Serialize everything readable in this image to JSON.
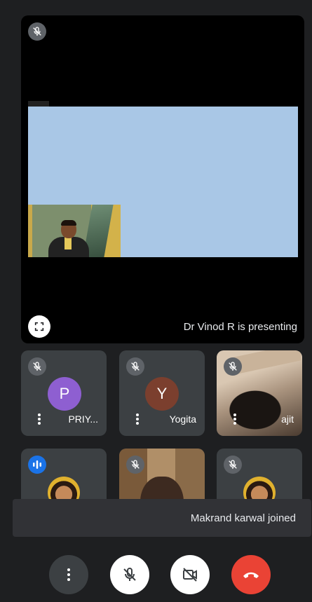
{
  "presenter": {
    "label": "Dr Vinod R is presenting"
  },
  "participants": [
    {
      "name": "ajit",
      "initial": ""
    },
    {
      "name": "Yogita",
      "initial": "Y",
      "color": "#7b3f2e"
    },
    {
      "name": "PRIY...",
      "initial": "P",
      "color": "#8e5fd1"
    }
  ],
  "notification": {
    "text": "Makrand karwal joined"
  },
  "colors": {
    "end_call": "#ea4335",
    "tile": "#3c4043",
    "speaking": "#1a73e8"
  }
}
